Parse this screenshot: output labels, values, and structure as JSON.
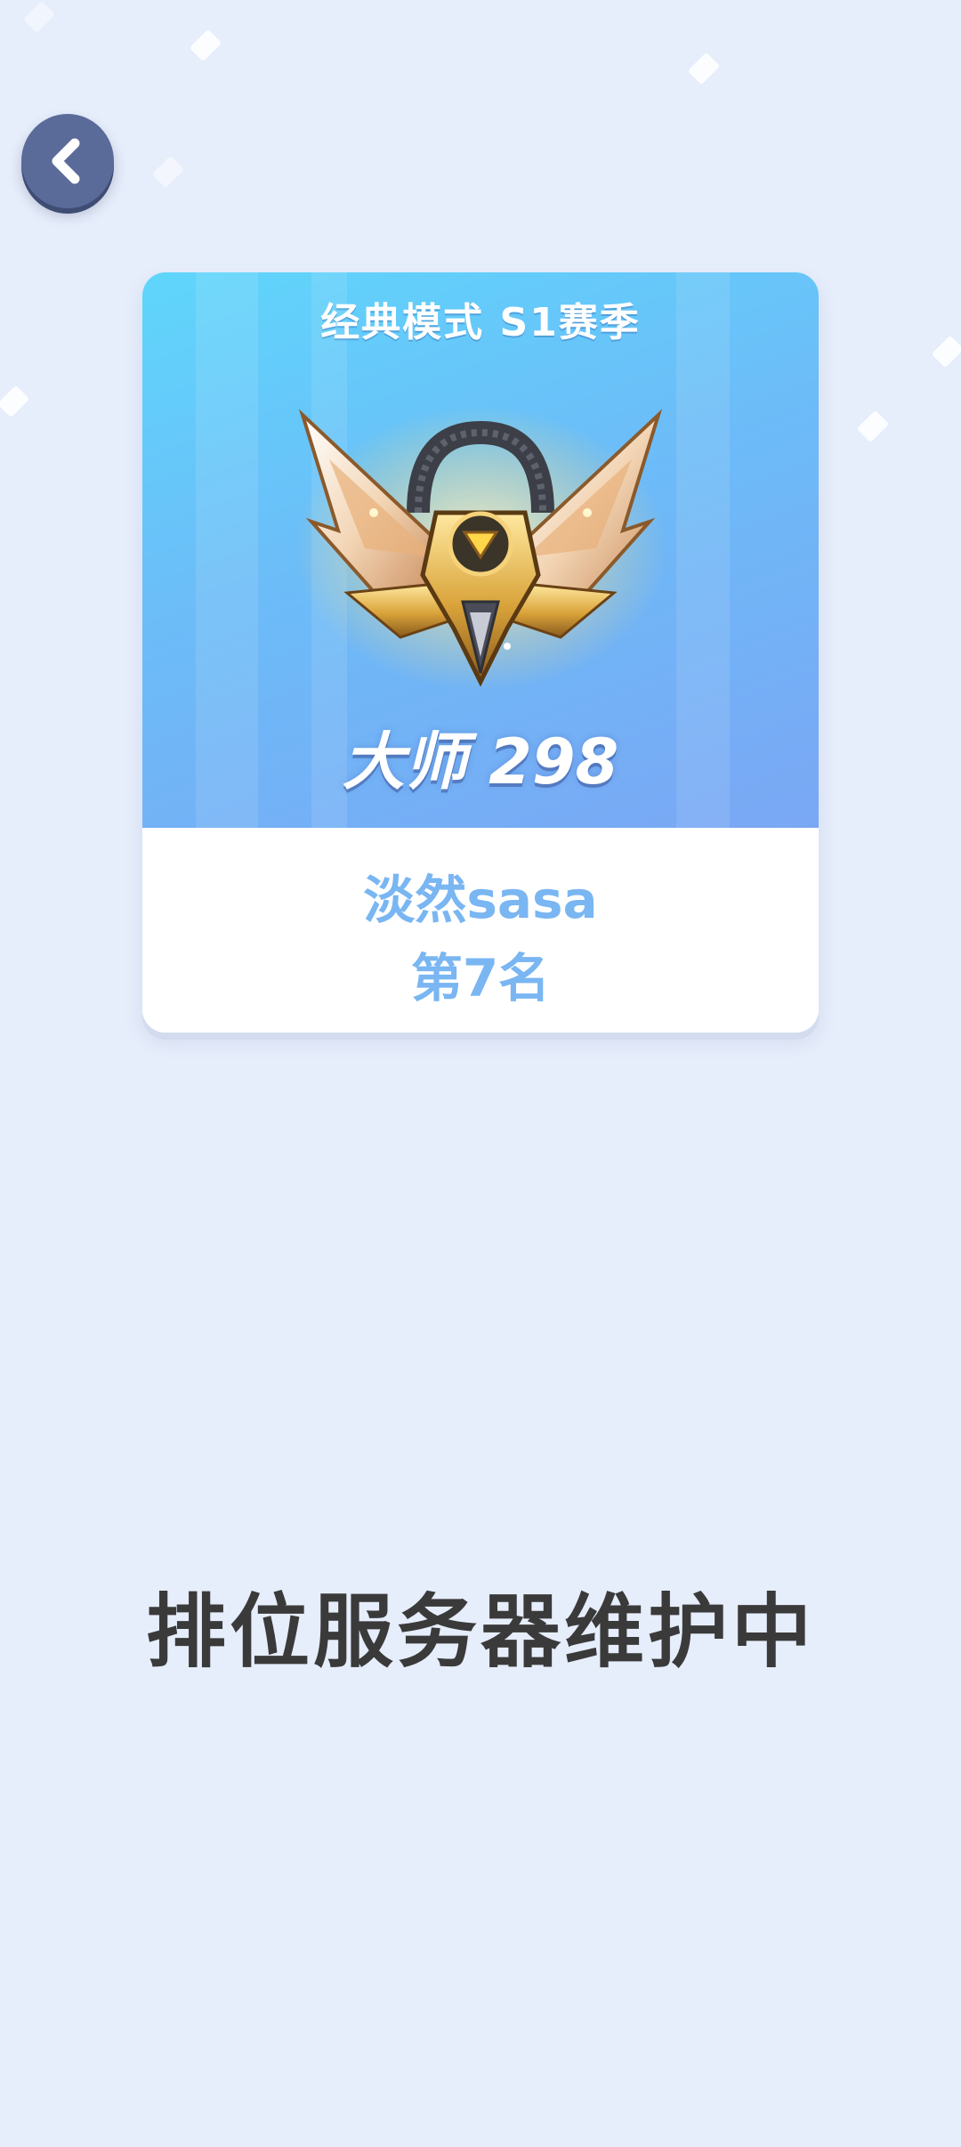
{
  "card": {
    "season_title": "经典模式 S1赛季",
    "rank_text": "大师 298",
    "player_name": "淡然sasa",
    "player_rank": "第7名"
  },
  "status": {
    "maintenance": "排位服务器维护中"
  },
  "icons": {
    "back": "chevron-left-icon",
    "emblem": "master-rank-emblem"
  },
  "colors": {
    "background": "#e6edfb",
    "back_button": "#5a6b99",
    "card_gradient_start": "#5fd6fb",
    "card_gradient_end": "#7aa7f4",
    "name_text": "#79b6f2",
    "maintenance_text": "#3a3a3a"
  }
}
